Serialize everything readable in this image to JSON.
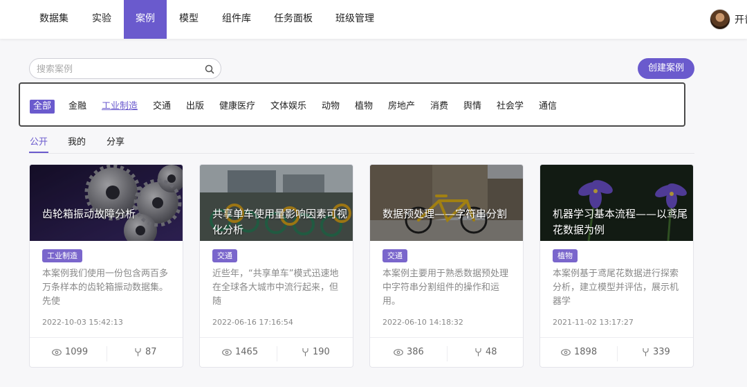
{
  "nav": {
    "items": [
      {
        "label": "数据集"
      },
      {
        "label": "实验"
      },
      {
        "label": "案例"
      },
      {
        "label": "模型"
      },
      {
        "label": "组件库"
      },
      {
        "label": "任务面板"
      },
      {
        "label": "班级管理"
      }
    ],
    "active": "案例",
    "user_name": "开普"
  },
  "search": {
    "placeholder": "搜索案例",
    "value": ""
  },
  "create_button": "创建案例",
  "categories": {
    "items": [
      "全部",
      "金融",
      "工业制造",
      "交通",
      "出版",
      "健康医疗",
      "文体娱乐",
      "动物",
      "植物",
      "房地产",
      "消费",
      "舆情",
      "社会学",
      "通信"
    ],
    "active": "全部",
    "hovered": "工业制造"
  },
  "tabs": {
    "items": [
      "公开",
      "我的",
      "分享"
    ],
    "active": "公开"
  },
  "accent_color": "#6a5acd",
  "cards": [
    {
      "title": "齿轮箱振动故障分析",
      "image_icon": "gears-image",
      "tag": "工业制造",
      "description": "本案例我们使用一份包含两百多万条样本的齿轮箱振动数据集。先使",
      "date": "2022-10-03 15:42:13",
      "views": "1099",
      "forks": "87"
    },
    {
      "title": "共享单车使用量影响因素可视化分析",
      "image_icon": "shared-bikes-image",
      "tag": "交通",
      "description": "近些年，“共享单车”模式迅速地在全球各大城市中流行起来，但随",
      "date": "2022-06-16 17:16:54",
      "views": "1465",
      "forks": "190"
    },
    {
      "title": "数据预处理——字符串分割",
      "image_icon": "yellow-bike-image",
      "tag": "交通",
      "description": "本案例主要用于熟悉数据预处理中字符串分割组件的操作和运用。",
      "date": "2022-06-10 14:18:32",
      "views": "386",
      "forks": "48"
    },
    {
      "title": "机器学习基本流程——以鸢尾花数据为例",
      "image_icon": "iris-flower-image",
      "tag": "植物",
      "description": "本案例基于鸢尾花数据进行探索分析，建立模型并评估，展示机器学",
      "date": "2021-11-02 13:17:27",
      "views": "1898",
      "forks": "339"
    }
  ]
}
